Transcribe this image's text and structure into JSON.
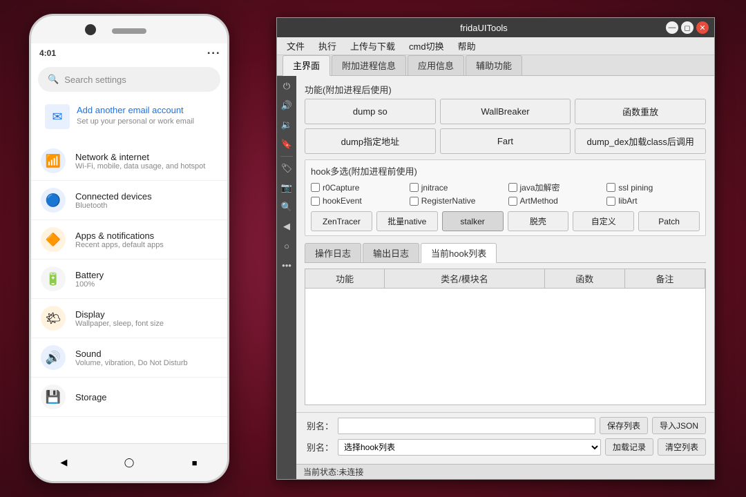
{
  "desktop": {
    "background": "dark red gradient"
  },
  "phone": {
    "status_time": "4:01",
    "status_icons": "wifi signal battery",
    "search_placeholder": "Search settings",
    "email_title": "Add another email account",
    "email_subtitle": "Set up your personal or work email",
    "settings_items": [
      {
        "icon": "wifi",
        "color": "#1a73e8",
        "bg": "#e8f0fe",
        "title": "Network & internet",
        "subtitle": "Wi-Fi, mobile, data usage, and hotspot"
      },
      {
        "icon": "bluetooth",
        "color": "#1a73e8",
        "bg": "#e8f0fe",
        "title": "Connected devices",
        "subtitle": "Bluetooth"
      },
      {
        "icon": "apps",
        "color": "#e65100",
        "bg": "#fff3e0",
        "title": "Apps & notifications",
        "subtitle": "Recent apps, default apps"
      },
      {
        "icon": "battery",
        "color": "#000",
        "bg": "#f5f5f5",
        "title": "Battery",
        "subtitle": "100%"
      },
      {
        "icon": "display",
        "color": "#fb8c00",
        "bg": "#fff3e0",
        "title": "Display",
        "subtitle": "Wallpaper, sleep, font size"
      },
      {
        "icon": "sound",
        "color": "#1a73e8",
        "bg": "#e8f0fe",
        "title": "Sound",
        "subtitle": "Volume, vibration, Do Not Disturb"
      },
      {
        "icon": "storage",
        "color": "#9e9e9e",
        "bg": "#f5f5f5",
        "title": "Storage",
        "subtitle": ""
      }
    ]
  },
  "frida_window": {
    "title": "fridaUITools",
    "menu_items": [
      "文件",
      "执行",
      "上传与下载",
      "cmd切换",
      "帮助"
    ],
    "tabs": [
      "主界面",
      "附加进程信息",
      "应用信息",
      "辅助功能"
    ],
    "active_tab": "主界面",
    "func_section_label": "功能(附加进程后使用)",
    "func_buttons": [
      "dump so",
      "WallBreaker",
      "函数重放",
      "dump指定地址",
      "Fart",
      "dump_dex加载class后调用"
    ],
    "hook_section_label": "hook多选(附加进程前使用)",
    "checkboxes": [
      {
        "label": "r0Capture",
        "checked": false
      },
      {
        "label": "jnitrace",
        "checked": false
      },
      {
        "label": "java加解密",
        "checked": false
      },
      {
        "label": "ssl pining",
        "checked": false
      },
      {
        "label": "hookEvent",
        "checked": false
      },
      {
        "label": "RegisterNative",
        "checked": false
      },
      {
        "label": "ArtMethod",
        "checked": false
      },
      {
        "label": "libArt",
        "checked": false
      }
    ],
    "hook_buttons": [
      "ZenTracer",
      "批量native",
      "stalker",
      "脱壳",
      "自定义",
      "Patch"
    ],
    "log_tabs": [
      "操作日志",
      "输出日志",
      "当前hook列表"
    ],
    "active_log_tab": "当前hook列表",
    "table_headers": [
      "功能",
      "类名/模块名",
      "函数",
      "备注"
    ],
    "table_rows": [],
    "alias_label": "别名：",
    "alias_placeholder": "",
    "save_list_btn": "保存列表",
    "import_json_btn": "导入JSON",
    "alias2_label": "别名：",
    "select_hook_placeholder": "选择hook列表",
    "load_record_btn": "加载记录",
    "clear_list_btn": "清空列表",
    "status_text": "当前状态:未连接"
  }
}
